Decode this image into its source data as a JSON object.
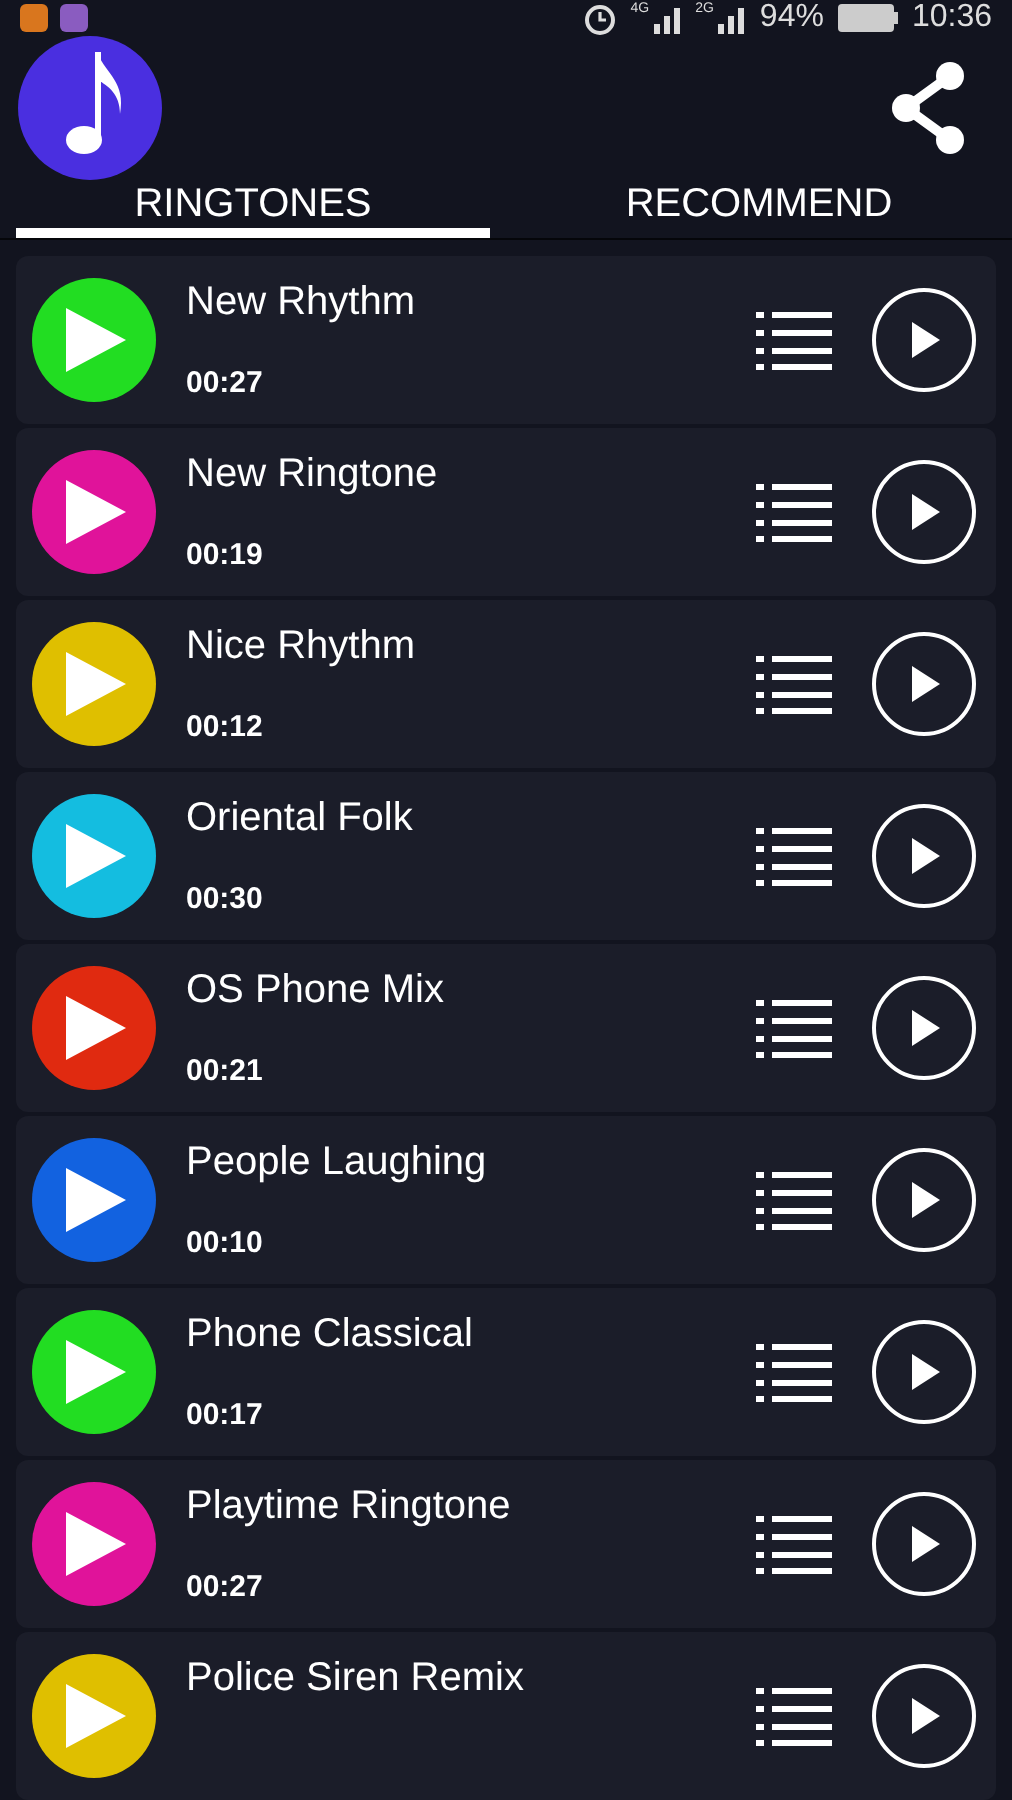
{
  "status_bar": {
    "battery": "94%",
    "time": "10:36",
    "network_1": "4G",
    "network_2": "2G"
  },
  "tabs": [
    {
      "label": "RINGTONES",
      "selected": true
    },
    {
      "label": "RECOMMEND",
      "selected": false
    }
  ],
  "ringtones": [
    {
      "title": "New Rhythm",
      "duration": "00:27",
      "color": "#22dd22"
    },
    {
      "title": "New Ringtone",
      "duration": "00:19",
      "color": "#e0139a"
    },
    {
      "title": "Nice Rhythm",
      "duration": "00:12",
      "color": "#dfbf00"
    },
    {
      "title": "Oriental Folk",
      "duration": "00:30",
      "color": "#14bde0"
    },
    {
      "title": "OS Phone Mix",
      "duration": "00:21",
      "color": "#e02a10"
    },
    {
      "title": "People Laughing",
      "duration": "00:10",
      "color": "#1262e0"
    },
    {
      "title": "Phone Classical",
      "duration": "00:17",
      "color": "#22dd22"
    },
    {
      "title": "Playtime Ringtone",
      "duration": "00:27",
      "color": "#e0139a"
    },
    {
      "title": "Police Siren Remix",
      "color": "#dfbf00"
    }
  ]
}
